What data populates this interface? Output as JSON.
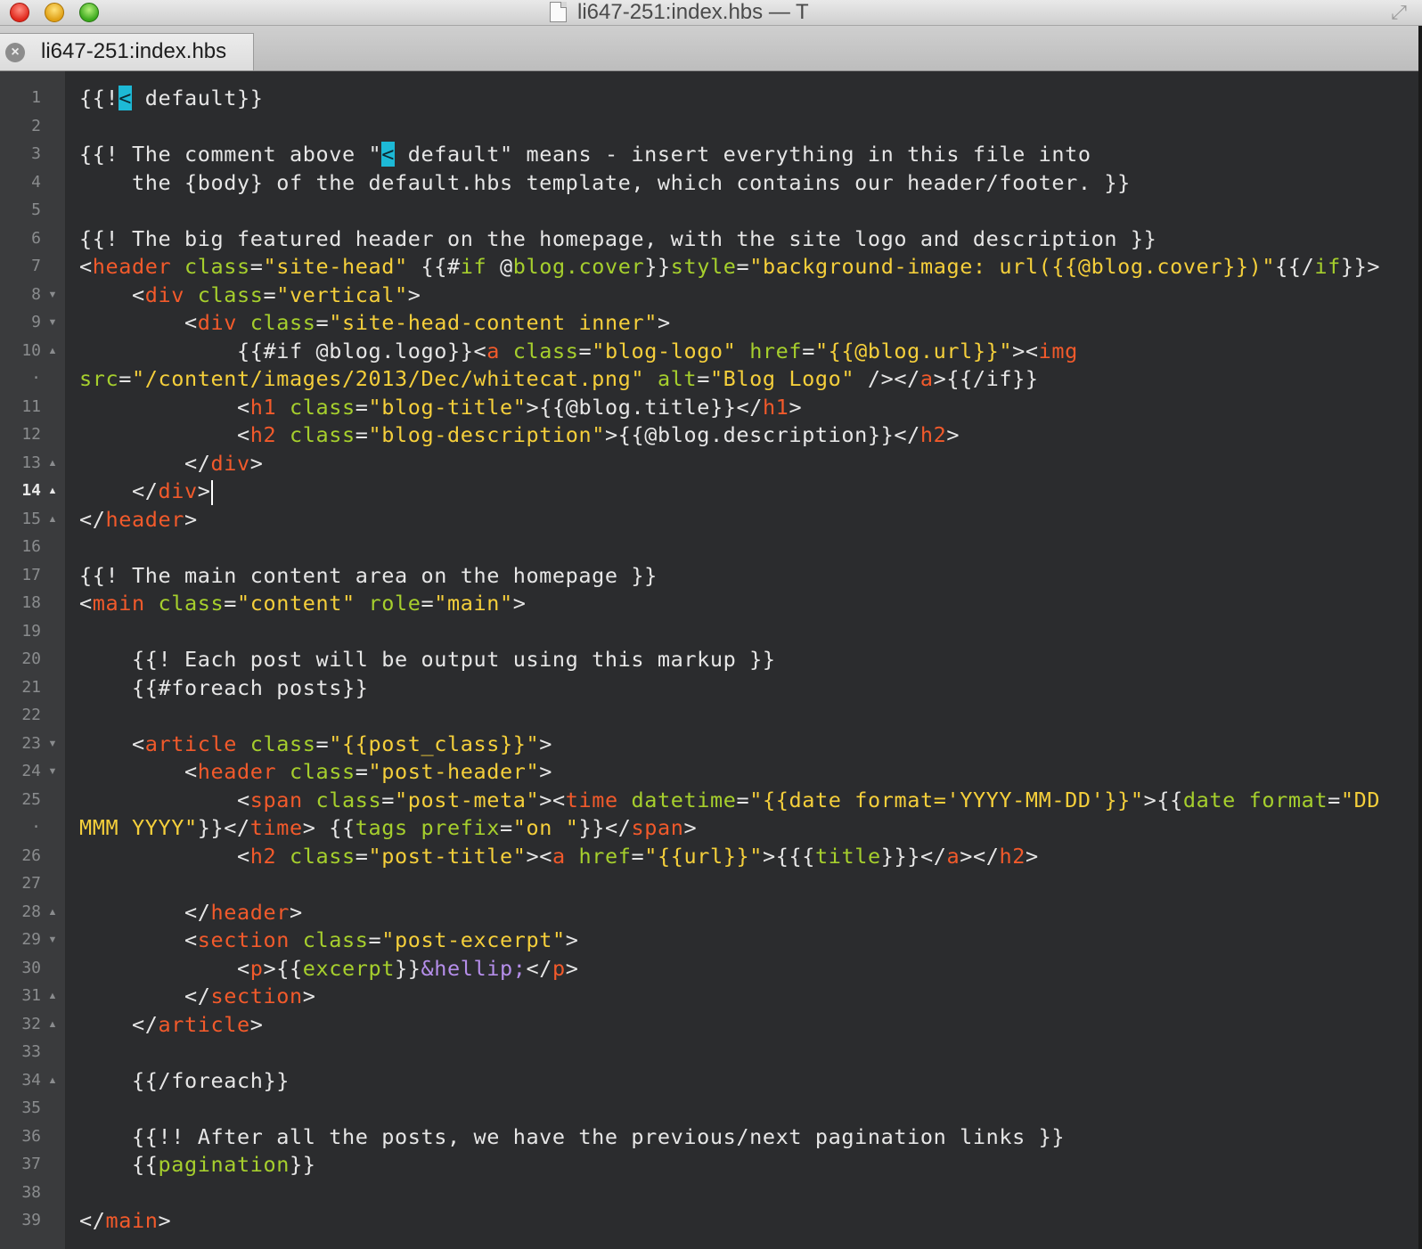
{
  "window": {
    "title": "li647-251:index.hbs — T",
    "controls": [
      "close",
      "minimize",
      "zoom"
    ]
  },
  "tabs": [
    {
      "label": "li647-251:index.hbs",
      "active": true
    }
  ],
  "editor": {
    "active_line": "14",
    "lines": [
      {
        "num": "1",
        "fold": "",
        "segs": [
          [
            "t",
            "{{!"
          ],
          [
            "sel",
            "<"
          ],
          [
            "t",
            " default}}"
          ]
        ]
      },
      {
        "num": "2",
        "fold": "",
        "segs": []
      },
      {
        "num": "3",
        "fold": "",
        "segs": [
          [
            "t",
            "{{! The comment above \""
          ],
          [
            "sel",
            "<"
          ],
          [
            "t",
            " default\" means - insert everything in this file into"
          ]
        ]
      },
      {
        "num": "4",
        "fold": "",
        "segs": [
          [
            "t",
            "    the {body} of the default.hbs template, which contains our header/footer. }}"
          ]
        ]
      },
      {
        "num": "5",
        "fold": "",
        "segs": []
      },
      {
        "num": "6",
        "fold": "",
        "segs": [
          [
            "t",
            "{{! The big featured header on the homepage, with the site logo and description }}"
          ]
        ]
      },
      {
        "num": "7",
        "fold": "",
        "segs": [
          [
            "t",
            "<"
          ],
          [
            "tag",
            "header"
          ],
          [
            "t",
            " "
          ],
          [
            "attr",
            "class"
          ],
          [
            "t",
            "="
          ],
          [
            "str",
            "\"site-head\""
          ],
          [
            "t",
            " {{#"
          ],
          [
            "hbs",
            "if"
          ],
          [
            "t",
            " @"
          ],
          [
            "hbs",
            "blog.cover"
          ],
          [
            "t",
            "}}"
          ],
          [
            "attr",
            "style"
          ],
          [
            "t",
            "="
          ],
          [
            "str",
            "\"background-image: url({{@blog.cover}})\""
          ],
          [
            "t",
            "{{/"
          ],
          [
            "hbs",
            "if"
          ],
          [
            "t",
            "}}>"
          ]
        ]
      },
      {
        "num": "8",
        "fold": "▼",
        "segs": [
          [
            "t",
            "    <"
          ],
          [
            "tag",
            "div"
          ],
          [
            "t",
            " "
          ],
          [
            "attr",
            "class"
          ],
          [
            "t",
            "="
          ],
          [
            "str",
            "\"vertical\""
          ],
          [
            "t",
            ">"
          ]
        ]
      },
      {
        "num": "9",
        "fold": "▼",
        "segs": [
          [
            "t",
            "        <"
          ],
          [
            "tag",
            "div"
          ],
          [
            "t",
            " "
          ],
          [
            "attr",
            "class"
          ],
          [
            "t",
            "="
          ],
          [
            "str",
            "\"site-head-content inner\""
          ],
          [
            "t",
            ">"
          ]
        ]
      },
      {
        "num": "10",
        "fold": "▲",
        "segs": [
          [
            "t",
            "            {{#if @blog.logo}}<"
          ],
          [
            "tag",
            "a"
          ],
          [
            "t",
            " "
          ],
          [
            "attr",
            "class"
          ],
          [
            "t",
            "="
          ],
          [
            "str",
            "\"blog-logo\""
          ],
          [
            "t",
            " "
          ],
          [
            "attr",
            "href"
          ],
          [
            "t",
            "="
          ],
          [
            "str",
            "\"{{@blog.url}}\""
          ],
          [
            "t",
            "><"
          ],
          [
            "tag",
            "img"
          ]
        ]
      },
      {
        "num": "·",
        "fold": "",
        "segs": [
          [
            "attr",
            "src"
          ],
          [
            "t",
            "="
          ],
          [
            "str",
            "\"/content/images/2013/Dec/whitecat.png\""
          ],
          [
            "t",
            " "
          ],
          [
            "attr",
            "alt"
          ],
          [
            "t",
            "="
          ],
          [
            "str",
            "\"Blog Logo\""
          ],
          [
            "t",
            " /></"
          ],
          [
            "tag",
            "a"
          ],
          [
            "t",
            ">{{/if}}"
          ]
        ]
      },
      {
        "num": "11",
        "fold": "",
        "segs": [
          [
            "t",
            "            <"
          ],
          [
            "tag",
            "h1"
          ],
          [
            "t",
            " "
          ],
          [
            "attr",
            "class"
          ],
          [
            "t",
            "="
          ],
          [
            "str",
            "\"blog-title\""
          ],
          [
            "t",
            ">{{@blog.title}}</"
          ],
          [
            "tag",
            "h1"
          ],
          [
            "t",
            ">"
          ]
        ]
      },
      {
        "num": "12",
        "fold": "",
        "segs": [
          [
            "t",
            "            <"
          ],
          [
            "tag",
            "h2"
          ],
          [
            "t",
            " "
          ],
          [
            "attr",
            "class"
          ],
          [
            "t",
            "="
          ],
          [
            "str",
            "\"blog-description\""
          ],
          [
            "t",
            ">{{@blog.description}}</"
          ],
          [
            "tag",
            "h2"
          ],
          [
            "t",
            ">"
          ]
        ]
      },
      {
        "num": "13",
        "fold": "▲",
        "segs": [
          [
            "t",
            "        </"
          ],
          [
            "tag",
            "div"
          ],
          [
            "t",
            ">"
          ]
        ]
      },
      {
        "num": "14",
        "fold": "▲",
        "segs": [
          [
            "t",
            "    </"
          ],
          [
            "tag",
            "div"
          ],
          [
            "t",
            ">"
          ],
          [
            "cursor",
            ""
          ]
        ]
      },
      {
        "num": "15",
        "fold": "▲",
        "segs": [
          [
            "t",
            "</"
          ],
          [
            "tag",
            "header"
          ],
          [
            "t",
            ">"
          ]
        ]
      },
      {
        "num": "16",
        "fold": "",
        "segs": []
      },
      {
        "num": "17",
        "fold": "",
        "segs": [
          [
            "t",
            "{{! The main content area on the homepage }}"
          ]
        ]
      },
      {
        "num": "18",
        "fold": "",
        "segs": [
          [
            "t",
            "<"
          ],
          [
            "tag",
            "main"
          ],
          [
            "t",
            " "
          ],
          [
            "attr",
            "class"
          ],
          [
            "t",
            "="
          ],
          [
            "str",
            "\"content\""
          ],
          [
            "t",
            " "
          ],
          [
            "attr",
            "role"
          ],
          [
            "t",
            "="
          ],
          [
            "str",
            "\"main\""
          ],
          [
            "t",
            ">"
          ]
        ]
      },
      {
        "num": "19",
        "fold": "",
        "segs": []
      },
      {
        "num": "20",
        "fold": "",
        "segs": [
          [
            "t",
            "    {{! Each post will be output using this markup }}"
          ]
        ]
      },
      {
        "num": "21",
        "fold": "",
        "segs": [
          [
            "t",
            "    {{#foreach posts}}"
          ]
        ]
      },
      {
        "num": "22",
        "fold": "",
        "segs": []
      },
      {
        "num": "23",
        "fold": "▼",
        "segs": [
          [
            "t",
            "    <"
          ],
          [
            "tag",
            "article"
          ],
          [
            "t",
            " "
          ],
          [
            "attr",
            "class"
          ],
          [
            "t",
            "="
          ],
          [
            "str",
            "\"{{post_class}}\""
          ],
          [
            "t",
            ">"
          ]
        ]
      },
      {
        "num": "24",
        "fold": "▼",
        "segs": [
          [
            "t",
            "        <"
          ],
          [
            "tag",
            "header"
          ],
          [
            "t",
            " "
          ],
          [
            "attr",
            "class"
          ],
          [
            "t",
            "="
          ],
          [
            "str",
            "\"post-header\""
          ],
          [
            "t",
            ">"
          ]
        ]
      },
      {
        "num": "25",
        "fold": "",
        "segs": [
          [
            "t",
            "            <"
          ],
          [
            "tag",
            "span"
          ],
          [
            "t",
            " "
          ],
          [
            "attr",
            "class"
          ],
          [
            "t",
            "="
          ],
          [
            "str",
            "\"post-meta\""
          ],
          [
            "t",
            "><"
          ],
          [
            "tag",
            "time"
          ],
          [
            "t",
            " "
          ],
          [
            "attr",
            "datetime"
          ],
          [
            "t",
            "="
          ],
          [
            "str",
            "\"{{date format='YYYY-MM-DD'}}\""
          ],
          [
            "t",
            ">{{"
          ],
          [
            "hbs",
            "date"
          ],
          [
            "t",
            " "
          ],
          [
            "hbs",
            "format"
          ],
          [
            "t",
            "="
          ],
          [
            "str",
            "\"DD"
          ]
        ]
      },
      {
        "num": "·",
        "fold": "",
        "segs": [
          [
            "str",
            "MMM YYYY\""
          ],
          [
            "t",
            "}}</"
          ],
          [
            "tag",
            "time"
          ],
          [
            "t",
            "> {{"
          ],
          [
            "hbs",
            "tags"
          ],
          [
            "t",
            " "
          ],
          [
            "hbs",
            "prefix"
          ],
          [
            "t",
            "="
          ],
          [
            "str",
            "\"on \""
          ],
          [
            "t",
            "}}</"
          ],
          [
            "tag",
            "span"
          ],
          [
            "t",
            ">"
          ]
        ]
      },
      {
        "num": "26",
        "fold": "",
        "segs": [
          [
            "t",
            "            <"
          ],
          [
            "tag",
            "h2"
          ],
          [
            "t",
            " "
          ],
          [
            "attr",
            "class"
          ],
          [
            "t",
            "="
          ],
          [
            "str",
            "\"post-title\""
          ],
          [
            "t",
            "><"
          ],
          [
            "tag",
            "a"
          ],
          [
            "t",
            " "
          ],
          [
            "attr",
            "href"
          ],
          [
            "t",
            "="
          ],
          [
            "str",
            "\"{{url}}\""
          ],
          [
            "t",
            ">{{{"
          ],
          [
            "hbs",
            "title"
          ],
          [
            "t",
            "}}}</"
          ],
          [
            "tag",
            "a"
          ],
          [
            "t",
            "></"
          ],
          [
            "tag",
            "h2"
          ],
          [
            "t",
            ">"
          ]
        ]
      },
      {
        "num": "27",
        "fold": "",
        "segs": []
      },
      {
        "num": "28",
        "fold": "▲",
        "segs": [
          [
            "t",
            "        </"
          ],
          [
            "tag",
            "header"
          ],
          [
            "t",
            ">"
          ]
        ]
      },
      {
        "num": "29",
        "fold": "▼",
        "segs": [
          [
            "t",
            "        <"
          ],
          [
            "tag",
            "section"
          ],
          [
            "t",
            " "
          ],
          [
            "attr",
            "class"
          ],
          [
            "t",
            "="
          ],
          [
            "str",
            "\"post-excerpt\""
          ],
          [
            "t",
            ">"
          ]
        ]
      },
      {
        "num": "30",
        "fold": "",
        "segs": [
          [
            "t",
            "            <"
          ],
          [
            "tag",
            "p"
          ],
          [
            "t",
            ">{{"
          ],
          [
            "hbs",
            "excerpt"
          ],
          [
            "t",
            "}}"
          ],
          [
            "ent",
            "&hellip;"
          ],
          [
            "t",
            "</"
          ],
          [
            "tag",
            "p"
          ],
          [
            "t",
            ">"
          ]
        ]
      },
      {
        "num": "31",
        "fold": "▲",
        "segs": [
          [
            "t",
            "        </"
          ],
          [
            "tag",
            "section"
          ],
          [
            "t",
            ">"
          ]
        ]
      },
      {
        "num": "32",
        "fold": "▲",
        "segs": [
          [
            "t",
            "    </"
          ],
          [
            "tag",
            "article"
          ],
          [
            "t",
            ">"
          ]
        ]
      },
      {
        "num": "33",
        "fold": "",
        "segs": []
      },
      {
        "num": "34",
        "fold": "▲",
        "segs": [
          [
            "t",
            "    {{/foreach}}"
          ]
        ]
      },
      {
        "num": "35",
        "fold": "",
        "segs": []
      },
      {
        "num": "36",
        "fold": "",
        "segs": [
          [
            "t",
            "    {{!! After all the posts, we have the previous/next pagination links }}"
          ]
        ]
      },
      {
        "num": "37",
        "fold": "",
        "segs": [
          [
            "t",
            "    {{"
          ],
          [
            "hbs",
            "pagination"
          ],
          [
            "t",
            "}}"
          ]
        ]
      },
      {
        "num": "38",
        "fold": "",
        "segs": []
      },
      {
        "num": "39",
        "fold": "",
        "segs": [
          [
            "t",
            "</"
          ],
          [
            "tag",
            "main"
          ],
          [
            "t",
            ">"
          ]
        ]
      }
    ]
  },
  "colors": {
    "background": "#2b2c2e",
    "gutter": "#3a3b3d",
    "tag": "#f25a2b",
    "attribute": "#a6cf2d",
    "string": "#f5cf3b",
    "entity": "#b58eea",
    "selection": "#1db9d6"
  }
}
